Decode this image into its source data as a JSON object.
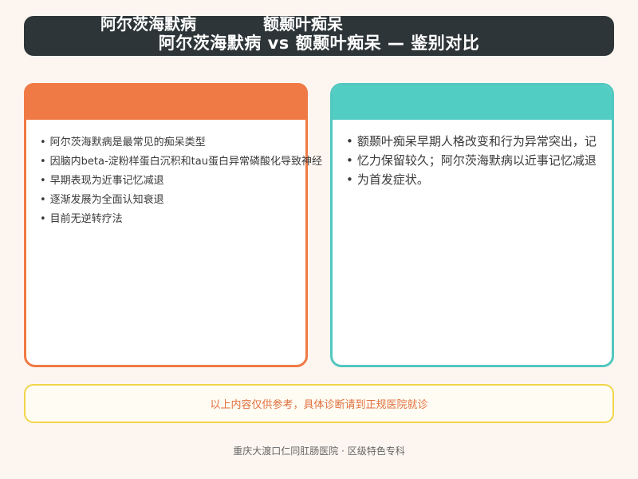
{
  "title": "阿尔茨海默病 vs 额颞叶痴呆 — 鉴别对比",
  "left_card": {
    "title": "阿尔茨海默病",
    "items": [
      "阿尔茨海默病是最常见的痴呆类型",
      "因脑内beta-淀粉样蛋白沉积和tau蛋白异常磷酸化导致神经",
      "早期表现为近事记忆减退",
      "逐渐发展为全面认知衰退",
      "目前无逆转疗法"
    ]
  },
  "right_card": {
    "title": "额颞叶痴呆",
    "items": [
      "额颞叶痴呆早期人格改变和行为异常突出，记",
      "忆力保留较久；阿尔茨海默病以近事记忆减退",
      "为首发症状。"
    ]
  },
  "note": "以上内容仅供参考，具体诊断请到正规医院就诊",
  "footer": "重庆大渡口仁同肛肠医院 · 区级特色专科",
  "colors": {
    "title_bg": "#2e3538",
    "left_accent": "#f07a45",
    "right_accent": "#52c7bf",
    "note_border": "#f1d54a",
    "note_text": "#e0703f",
    "background": "#fdf6f0"
  }
}
